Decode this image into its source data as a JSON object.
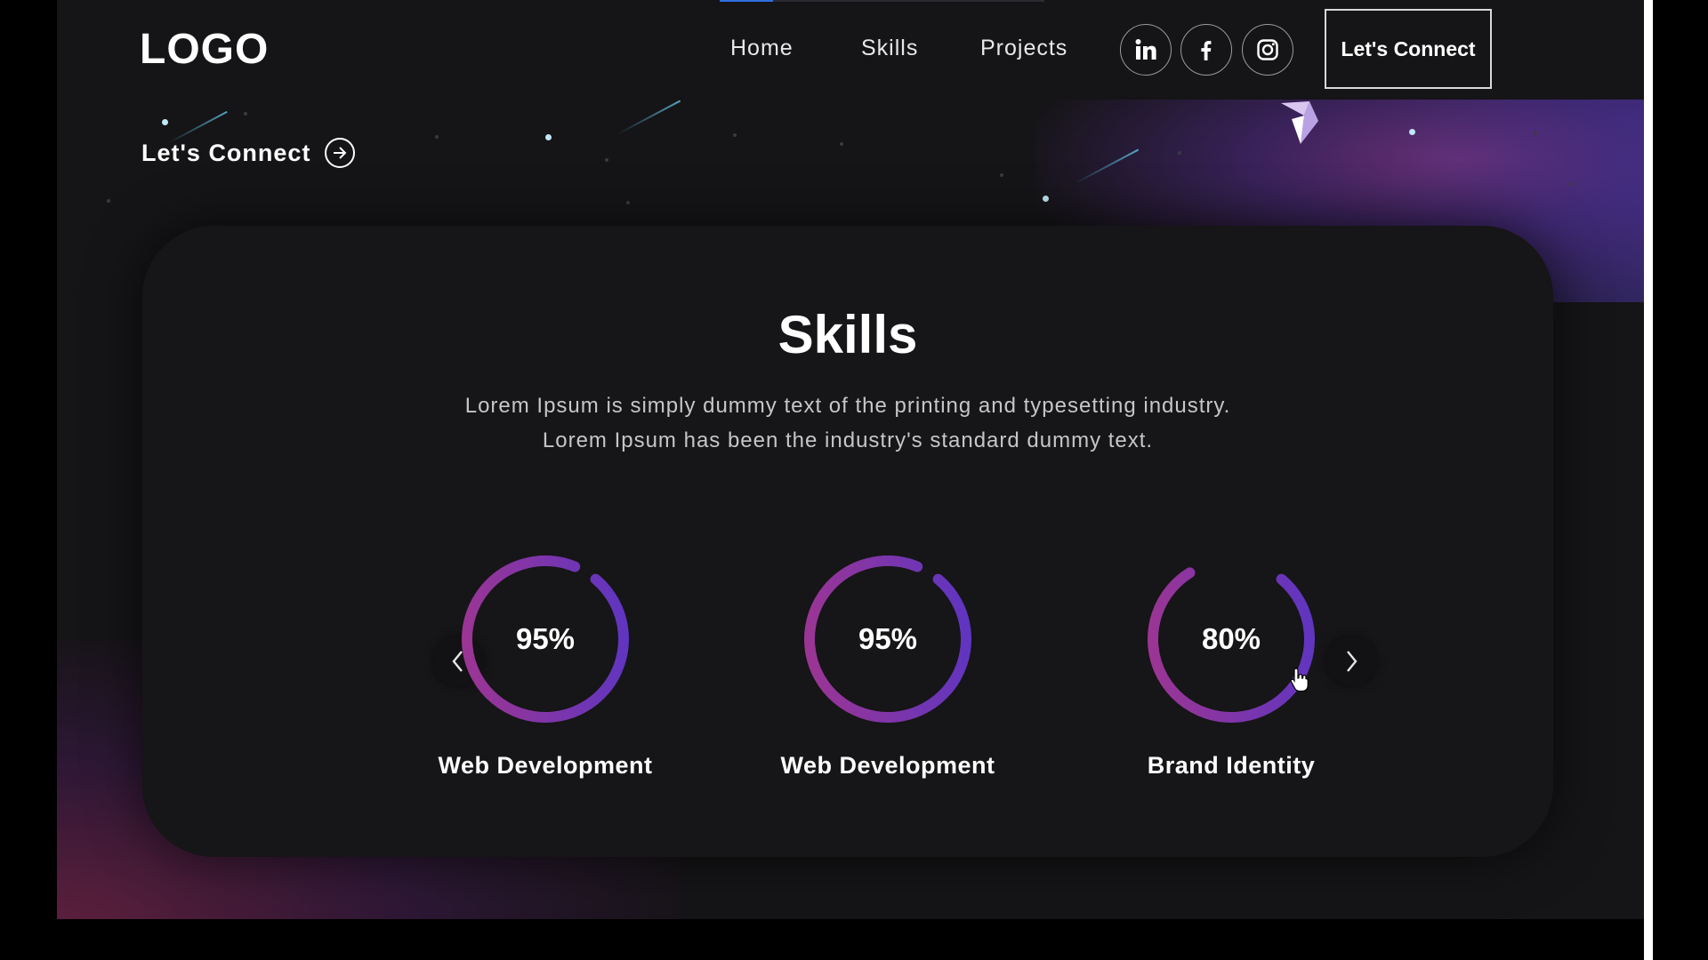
{
  "nav": {
    "logo": "LOGO",
    "items": [
      {
        "label": "Home"
      },
      {
        "label": "Skills"
      },
      {
        "label": "Projects"
      }
    ],
    "social": [
      "linkedin-icon",
      "facebook-icon",
      "instagram-icon"
    ],
    "connect_button": "Let's Connect"
  },
  "hero": {
    "connect_link": "Let's Connect"
  },
  "skills": {
    "title": "Skills",
    "description_line1": "Lorem Ipsum is simply dummy text of the printing and typesetting industry.",
    "description_line2": "Lorem Ipsum has been the industry's standard dummy text.",
    "items": [
      {
        "percent": 95,
        "percent_label": "95%",
        "label": "Web Development"
      },
      {
        "percent": 95,
        "percent_label": "95%",
        "label": "Web Development"
      },
      {
        "percent": 80,
        "percent_label": "80%",
        "label": "Brand Identity"
      }
    ]
  },
  "colors": {
    "background": "#151416",
    "ring_start": "#b23a8a",
    "ring_end": "#5b37c8",
    "accent_blue": "#2f6fe0"
  }
}
